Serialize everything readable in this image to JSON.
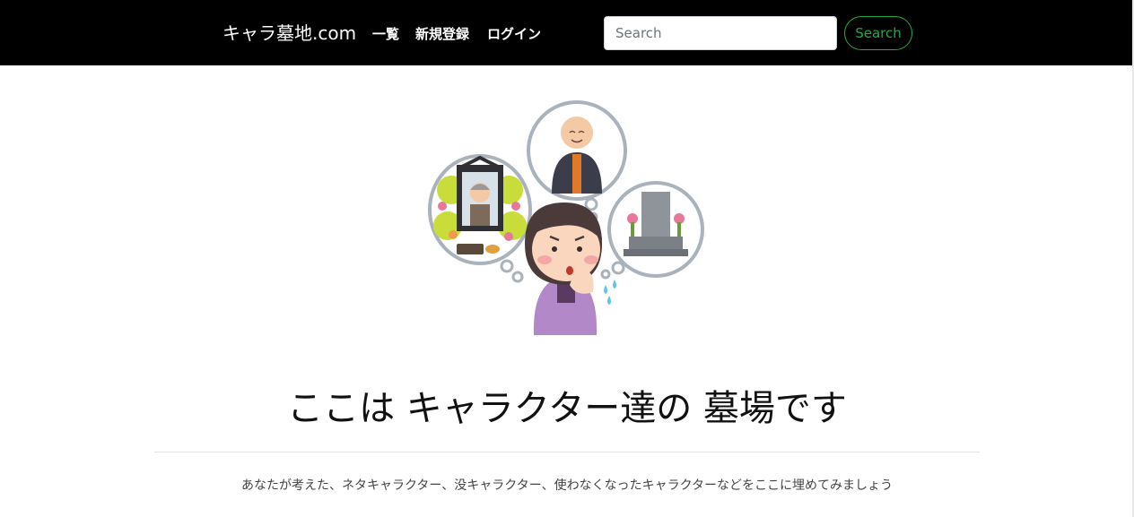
{
  "navbar": {
    "brand": "キャラ墓地.com",
    "links": [
      {
        "label": "一覧"
      },
      {
        "label": "新規登録"
      },
      {
        "label": "ログイン"
      }
    ],
    "search": {
      "placeholder": "Search",
      "value": "",
      "button_label": "Search"
    },
    "colors": {
      "background": "#000000",
      "text": "#ffffff",
      "search_button": "#28a745"
    }
  },
  "hero": {
    "illustration_icon": "worried-woman-thinking-funeral-illustration",
    "title": "ここは キャラクター達の 墓場です",
    "lead": "あなたが考えた、ネタキャラクター、没キャラクター、使わなくなったキャラクターなどをここに埋めてみましょう"
  }
}
